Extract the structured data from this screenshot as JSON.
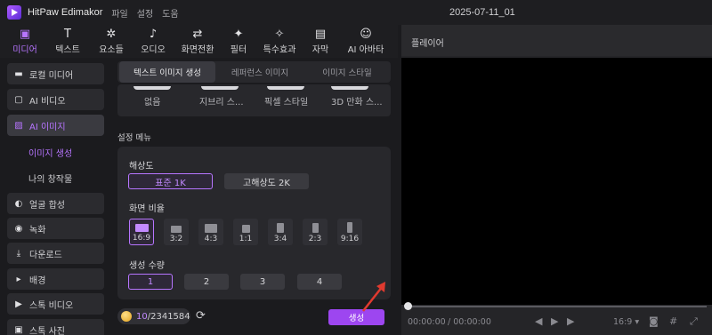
{
  "app": {
    "name": "HitPaw Edimakor",
    "project": "2025-07-11_01"
  },
  "menu": [
    "파일",
    "설정",
    "도움"
  ],
  "toolbar": [
    {
      "label": "미디어",
      "icon": "media-icon",
      "glyph": "▣"
    },
    {
      "label": "텍스트",
      "icon": "text-icon",
      "glyph": "T"
    },
    {
      "label": "요소들",
      "icon": "elements-icon",
      "glyph": "✲"
    },
    {
      "label": "오디오",
      "icon": "audio-icon",
      "glyph": "♪"
    },
    {
      "label": "화면전환",
      "icon": "transition-icon",
      "glyph": "⇄"
    },
    {
      "label": "필터",
      "icon": "filter-icon",
      "glyph": "✦"
    },
    {
      "label": "특수효과",
      "icon": "effects-icon",
      "glyph": "✧"
    },
    {
      "label": "자막",
      "icon": "subtitle-icon",
      "glyph": "▤"
    },
    {
      "label": "AI 아바타",
      "icon": "ai-avatar-icon",
      "glyph": "☺"
    }
  ],
  "sidebar": {
    "items": [
      {
        "label": "로컬 미디어",
        "icon": "folder-icon",
        "glyph": "▬"
      },
      {
        "label": "AI 비디오",
        "icon": "ai-video-icon",
        "glyph": "▢"
      },
      {
        "label": "AI 이미지",
        "icon": "ai-image-icon",
        "glyph": "▨"
      },
      {
        "label": "얼굴 합성",
        "icon": "face-swap-icon",
        "glyph": "◐"
      },
      {
        "label": "녹화",
        "icon": "record-icon",
        "glyph": "◉"
      },
      {
        "label": "다운로드",
        "icon": "download-icon",
        "glyph": "⤓"
      },
      {
        "label": "배경",
        "icon": "background-icon",
        "glyph": "▸"
      },
      {
        "label": "스톡 비디오",
        "icon": "stock-video-icon",
        "glyph": "▶"
      },
      {
        "label": "스톡 사진",
        "icon": "stock-photo-icon",
        "glyph": "▣"
      }
    ],
    "sub": [
      "이미지 생성",
      "나의 창작물"
    ]
  },
  "tabs": [
    "텍스트 이미지 생성",
    "레퍼런스 이미지",
    "이미지 스타일"
  ],
  "styles": [
    "없음",
    "지브리 스...",
    "픽셀 스타일",
    "3D 만화 스..."
  ],
  "settings": {
    "title": "설정 메뉴",
    "resolution_label": "해상도",
    "resolutions": [
      "표준 1K",
      "고해상도 2K"
    ],
    "ratio_label": "화면 비율",
    "ratios": [
      "16:9",
      "3:2",
      "4:3",
      "1:1",
      "3:4",
      "2:3",
      "9:16"
    ],
    "count_label": "생성 수량",
    "counts": [
      "1",
      "2",
      "3",
      "4"
    ]
  },
  "credits": {
    "used": "10",
    "total": "/2341584"
  },
  "generate_label": "생성",
  "player": {
    "title": "플레이어",
    "time_current": "00:00:00",
    "time_total": "/ 00:00:00",
    "aspect": "16:9 ▾"
  },
  "colors": {
    "accent": "#b775ff",
    "button": "#9d46f0",
    "arrow": "#e03a2f"
  }
}
